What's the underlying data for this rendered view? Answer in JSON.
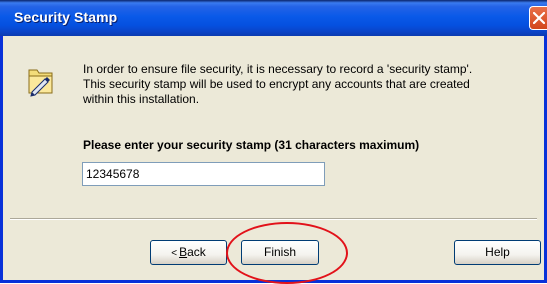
{
  "window": {
    "title": "Security Stamp"
  },
  "icons": {
    "folder": "folder-pen-icon",
    "close": "close-icon"
  },
  "intro": {
    "line1": "In order to ensure file security, it is necessary to record a 'security stamp'.",
    "line2": "This security stamp will be used to encrypt any accounts that are created",
    "line3": "within this installation."
  },
  "stamp": {
    "label": "Please enter your security stamp (31 characters maximum)",
    "value": "12345678"
  },
  "buttons": {
    "back_arrow": "<",
    "back_mnemonic": "B",
    "back_rest": "ack",
    "finish": "Finish",
    "help": "Help"
  },
  "colors": {
    "titlebar": "#0a5ae8",
    "close": "#d2461c",
    "annotation": "#e2121a",
    "dialog_bg": "#ece9d8"
  }
}
